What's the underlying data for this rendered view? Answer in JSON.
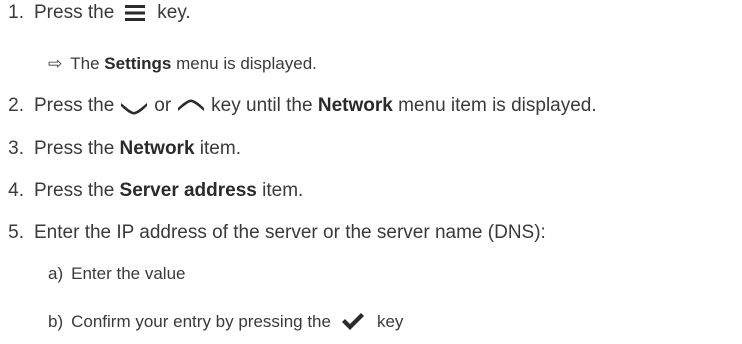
{
  "steps": [
    {
      "num": "1.",
      "pre": "Press the",
      "icon": "menu-icon",
      "post": "key."
    },
    {
      "arrow": "⇨",
      "pre": "The",
      "bold": "Settings",
      "post": "menu is displayed."
    },
    {
      "num": "2.",
      "pre": "Press the",
      "icon_a": "chevron-down-icon",
      "mid": "or",
      "icon_b": "chevron-up-icon",
      "post_a": "key until the",
      "bold": "Network",
      "post_b": "menu item is displayed."
    },
    {
      "num": "3.",
      "pre": "Press the",
      "bold": "Network",
      "post": "item."
    },
    {
      "num": "4.",
      "pre": "Press the",
      "bold": "Server address",
      "post": "item."
    },
    {
      "num": "5.",
      "text": "Enter the IP address of the server or the server name (DNS):"
    },
    {
      "letter": "a)",
      "text": "Enter the value"
    },
    {
      "letter": "b)",
      "pre": "Confirm your entry by pressing the",
      "icon": "checkmark-icon",
      "post": "key"
    }
  ],
  "colors": {
    "text": "#3a3a3a",
    "icon": "#2b2b2b"
  }
}
